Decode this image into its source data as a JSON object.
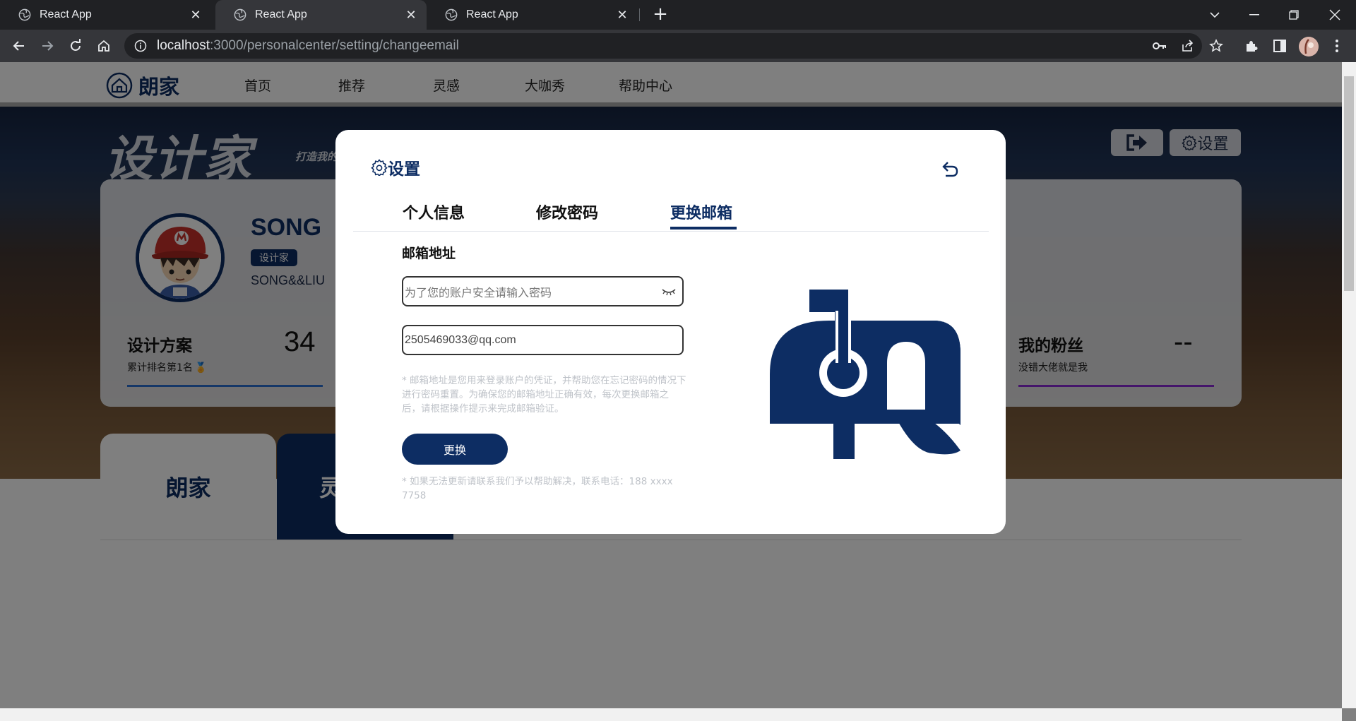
{
  "browser": {
    "tabs": [
      {
        "title": "React App",
        "active": false
      },
      {
        "title": "React App",
        "active": true
      },
      {
        "title": "React App",
        "active": false
      }
    ],
    "url_host": "localhost",
    "url_path": ":3000/personalcenter/setting/changeemail"
  },
  "site": {
    "brand": "朗家",
    "nav": [
      "首页",
      "推荐",
      "灵感",
      "大咖秀",
      "帮助中心"
    ]
  },
  "hero": {
    "title": "设计家",
    "slogan": "打造我的",
    "settings_label": "设置"
  },
  "profile": {
    "name": "SONG",
    "role": "设计家",
    "sub": "SONG&&LIU",
    "stats": [
      {
        "title": "设计方案",
        "sub": "累计排名第1名",
        "value": "34"
      },
      {
        "title": "我的粉丝",
        "sub": "没错大佬就是我",
        "value": "--"
      }
    ]
  },
  "section_tabs": [
    "朗家",
    "灵"
  ],
  "modal": {
    "title": "设置",
    "tabs": [
      "个人信息",
      "修改密码",
      "更换邮箱"
    ],
    "active_tab": "更换邮箱",
    "field_label": "邮箱地址",
    "password_placeholder": "为了您的账户安全请输入密码",
    "email_value": "2505469033@qq.com",
    "note": "* 邮箱地址是您用来登录账户的凭证，并帮助您在忘记密码的情况下进行密码重置。为确保您的邮箱地址正确有效，每次更换邮箱之后，请根据操作提示来完成邮箱验证。",
    "submit_label": "更换",
    "help_note": "* 如果无法更新请联系我们予以帮助解决，联系电话：188 xxxx 7758"
  },
  "colors": {
    "primary": "#0d2d63",
    "chrome_dark": "#202124",
    "chrome_toolbar": "#35363a"
  }
}
